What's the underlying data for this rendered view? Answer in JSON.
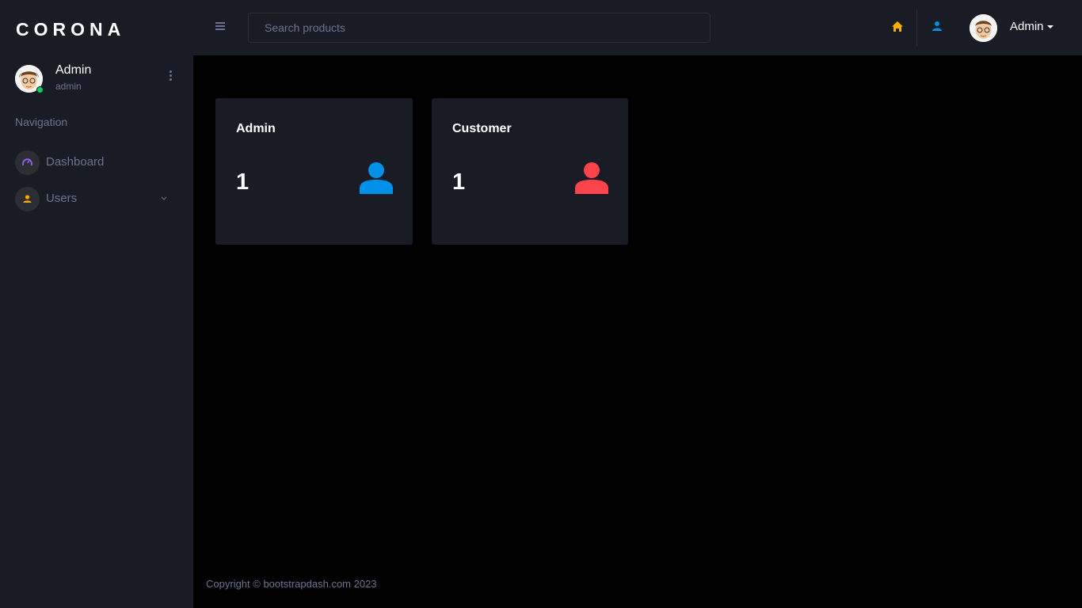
{
  "app": {
    "brand": "CORONA"
  },
  "sidebar": {
    "profile": {
      "name": "Admin",
      "role": "admin"
    },
    "heading": "Navigation",
    "items": [
      {
        "label": "Dashboard",
        "icon": "speedometer-icon",
        "icon_color": "#8f5fe8"
      },
      {
        "label": "Users",
        "icon": "user-icon",
        "icon_color": "#ffab00"
      }
    ]
  },
  "topbar": {
    "search_placeholder": "Search products",
    "user_name": "Admin",
    "home_icon_color": "#ffab00",
    "user_icon_color": "#0090e7"
  },
  "cards": [
    {
      "title": "Admin",
      "count": "1",
      "icon": "user-icon",
      "icon_color": "#0090e7"
    },
    {
      "title": "Customer",
      "count": "1",
      "icon": "user-icon",
      "icon_color": "#fc424a"
    }
  ],
  "footer": {
    "text": "Copyright © bootstrapdash.com 2023"
  }
}
